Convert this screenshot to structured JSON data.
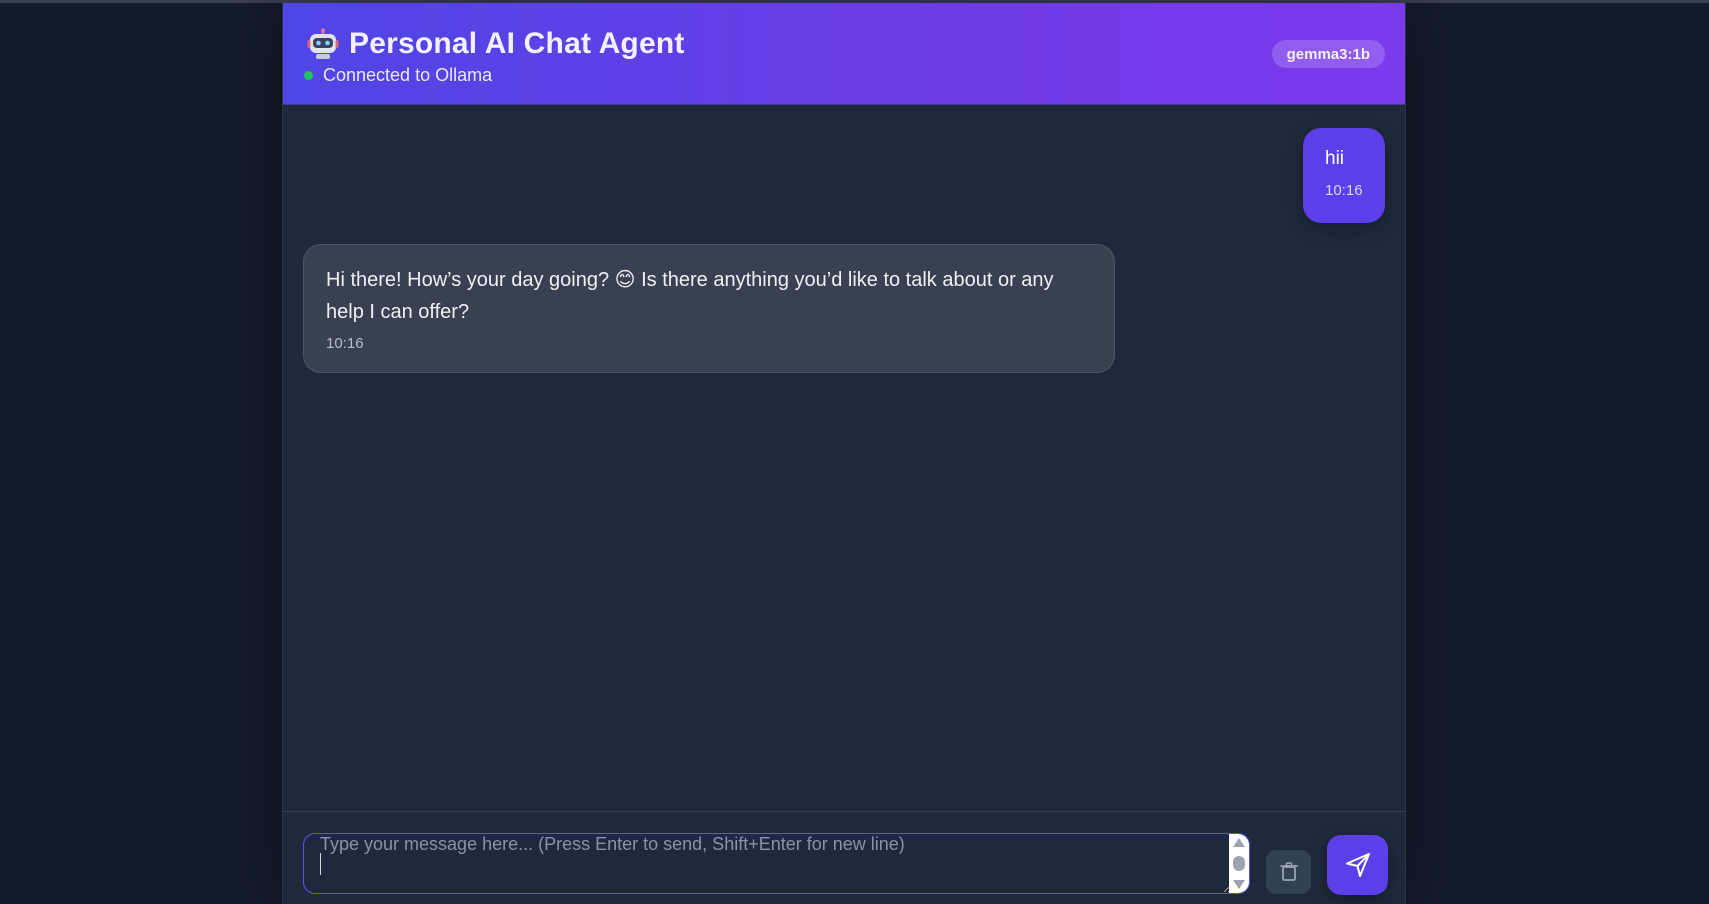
{
  "header": {
    "title": "Personal AI Chat Agent",
    "status": "Connected to Ollama",
    "model": "gemma3:1b",
    "logo_icon": "robot-icon"
  },
  "messages": [
    {
      "role": "user",
      "text": "hii",
      "time": "10:16"
    },
    {
      "role": "assistant",
      "text": "Hi there! How’s your day going? 😊 Is there anything you’d like to talk about or any help I can offer?",
      "time": "10:16"
    }
  ],
  "composer": {
    "placeholder": "Type your message here... (Press Enter to send, Shift+Enter for new line)",
    "value": "",
    "clear_icon": "trash-icon",
    "send_icon": "send-icon"
  },
  "colors": {
    "accent": "#5b3fe8",
    "header_gradient_start": "#4f46e5",
    "header_gradient_end": "#7c3aed",
    "status_online": "#22c55e",
    "background": "#1e293b",
    "bot_bubble": "#374151"
  }
}
